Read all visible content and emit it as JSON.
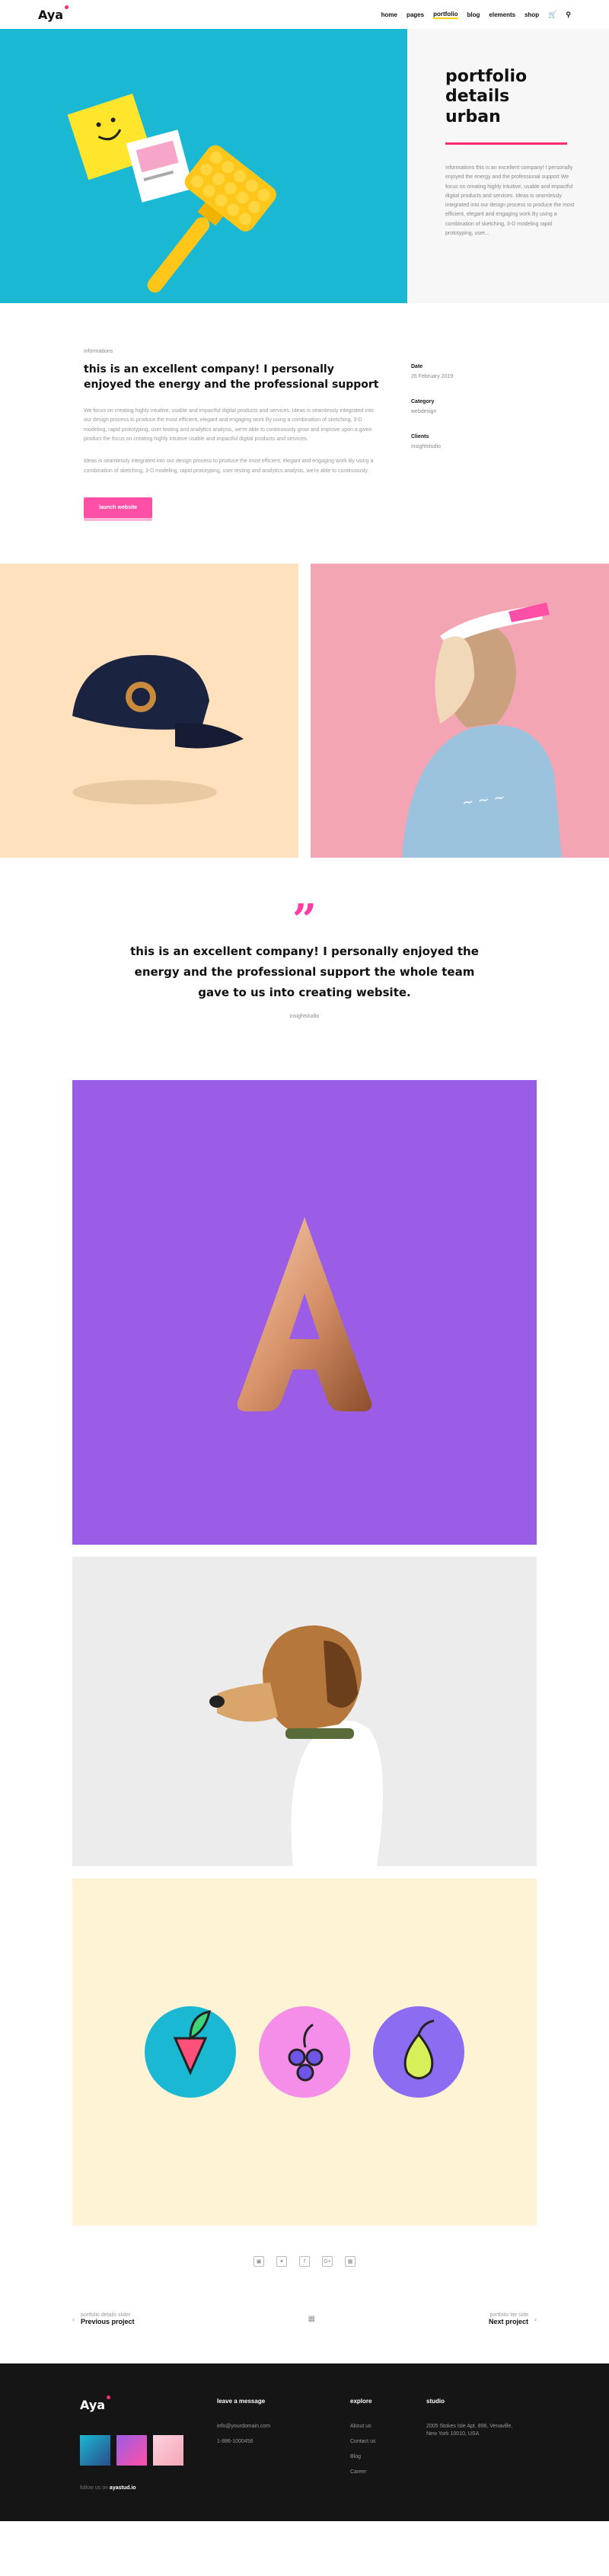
{
  "header": {
    "logo": "Aya",
    "nav": [
      "home",
      "pages",
      "portfolio",
      "blog",
      "elements",
      "shop"
    ],
    "cart_icon": "cart-icon",
    "search_icon": "search-icon"
  },
  "hero": {
    "title_lines": [
      "portfolio",
      "details",
      "urban"
    ],
    "text": "informations this is an excellent company! I personally enjoyed the energy and the professional support We focus on creating highly intuitive, usable and impactful digital products and services. Ideas is seamlessly integrated into our design process to produce the most efficient, elegant and engaging work By using a combination of sketching, 3-D modeling rapid prototyping, user..."
  },
  "info": {
    "kicker": "informations",
    "title": "this is an excellent company! I personally enjoyed the energy and the professional support",
    "para1": "We focus on creating highly intuitive, usable and impactful digital products and services. Ideas is seamlessly integrated into our design process to produce the most efficient, elegant and engaging work By using a combination of sketching, 3-D modeling, rapid prototyping, user testing and analytics analysis, we're able to continuously grow and improve upon a given product the focus on creating highly intuitive usable and impactful digital products and services.",
    "para2": "Ideas is seamlessly integrated into our design process to produce the most efficient, elegant and engaging work By using a combination of sketching, 3-D modeling, rapid prototyping, user testing and analytics analysis, we're able to continuously.",
    "button": "launch website",
    "meta": [
      {
        "label": "Date",
        "value": "26 February 2019"
      },
      {
        "label": "Category",
        "value": "webdesign"
      },
      {
        "label": "Clients",
        "value": "insightstudio"
      }
    ]
  },
  "quote": {
    "mark": "”",
    "text": "this is an excellent company! I personally enjoyed the energy and the professional support the whole team gave to us into creating website.",
    "author": "insightstudio"
  },
  "social": [
    "instagram-icon",
    "twitter-icon",
    "facebook-icon",
    "google-plus-icon",
    "pinterest-icon"
  ],
  "social_glyphs": [
    "▣",
    "✦",
    "f",
    "G+",
    "▦"
  ],
  "pager": {
    "prev_small": "portfolio details slider",
    "prev_big": "Previous project",
    "next_small": "portfolio lite side",
    "next_big": "Next project"
  },
  "footer": {
    "logo": "Aya",
    "message_head": "leave a message",
    "email": "info@yourdomain.com",
    "phone": "1-886-1000456",
    "explore_head": "explore",
    "explore": [
      "About us",
      "Contact us",
      "Blog",
      "Career"
    ],
    "studio_head": "studio",
    "address": "2005 Stokes Isle Apt. 896, Venaville, New York 10010, USA",
    "follow_prefix": "follow us on",
    "follow_handle": "ayastud.io"
  },
  "colors": {
    "accent": "#ff2a6d",
    "hero_bg": "#1ab8d3",
    "purple": "#9b5de5",
    "cream": "#fff3d6",
    "pink": "#f3a5b4",
    "peach": "#ffe2bd"
  }
}
